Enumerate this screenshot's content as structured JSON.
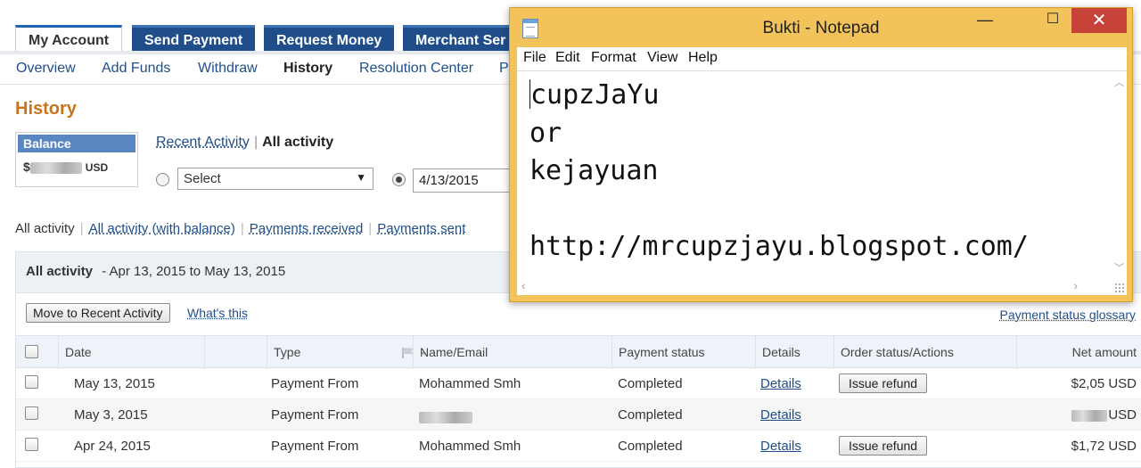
{
  "top_tabs": [
    {
      "label": "My Account",
      "active": true
    },
    {
      "label": "Send Payment",
      "active": false
    },
    {
      "label": "Request Money",
      "active": false
    },
    {
      "label": "Merchant Ser",
      "active": false
    }
  ],
  "sub_nav": [
    "Overview",
    "Add Funds",
    "Withdraw",
    "History",
    "Resolution Center",
    "P"
  ],
  "sub_nav_current": "History",
  "page_title": "History",
  "balance": {
    "label": "Balance",
    "prefix": "$",
    "currency": "USD"
  },
  "view_links": {
    "recent": "Recent Activity",
    "all": "All activity"
  },
  "select": {
    "value": "Select"
  },
  "date_from": "4/13/2015",
  "filter_links": [
    "All activity",
    "All activity (with balance)",
    "Payments received",
    "Payments sent"
  ],
  "panel": {
    "title": "All activity",
    "range": "- Apr 13, 2015 to May 13, 2015",
    "move_button": "Move to Recent Activity",
    "whats_this": "What's this",
    "glossary": "Payment status glossary"
  },
  "table": {
    "headers": [
      "Date",
      "",
      "Type",
      "Name/Email",
      "Payment status",
      "Details",
      "Order status/Actions",
      "Net amount"
    ],
    "rows": [
      {
        "date": "May 13, 2015",
        "type": "Payment From",
        "name": "Mohammed Smh",
        "status": "Completed",
        "details": "Details",
        "action": "Issue refund",
        "amount": "$2,05 USD"
      },
      {
        "date": "May 3, 2015",
        "type": "Payment From",
        "name": "",
        "status": "Completed",
        "details": "Details",
        "action": "",
        "amount": "USD"
      },
      {
        "date": "Apr 24, 2015",
        "type": "Payment From",
        "name": "Mohammed Smh",
        "status": "Completed",
        "details": "Details",
        "action": "Issue refund",
        "amount": "$1,72 USD"
      }
    ]
  },
  "notepad": {
    "title": "Bukti - Notepad",
    "menu": [
      "File",
      "Edit",
      "Format",
      "View",
      "Help"
    ],
    "lines": [
      "cupzJaYu",
      "or",
      "kejayuan",
      "",
      "http://mrcupzjayu.blogspot.com/"
    ],
    "close_glyph": "✕",
    "maximize_glyph": "☐",
    "minimize_glyph": "—"
  }
}
